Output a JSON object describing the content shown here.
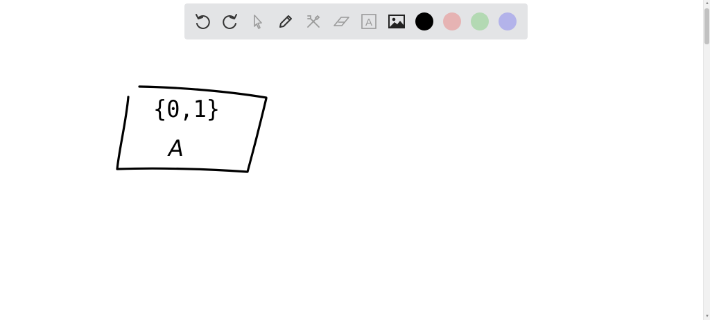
{
  "toolbar": {
    "tools": [
      {
        "name": "undo",
        "icon": "undo-icon"
      },
      {
        "name": "redo",
        "icon": "redo-icon"
      },
      {
        "name": "select",
        "icon": "cursor-arrow-icon"
      },
      {
        "name": "pen",
        "icon": "pencil-icon"
      },
      {
        "name": "tools",
        "icon": "crossed-tools-icon"
      },
      {
        "name": "eraser",
        "icon": "eraser-icon"
      },
      {
        "name": "text",
        "icon": "text-box-icon",
        "glyph": "A"
      },
      {
        "name": "image",
        "icon": "image-icon"
      }
    ],
    "colors": [
      {
        "name": "black",
        "hex": "#000000"
      },
      {
        "name": "red",
        "hex": "#e6b3b3"
      },
      {
        "name": "green",
        "hex": "#b3d9b3"
      },
      {
        "name": "blue",
        "hex": "#b3b3ea"
      }
    ]
  },
  "canvas": {
    "set_label": "{0,1}",
    "node_label": "A",
    "ink_color": "#000000"
  }
}
